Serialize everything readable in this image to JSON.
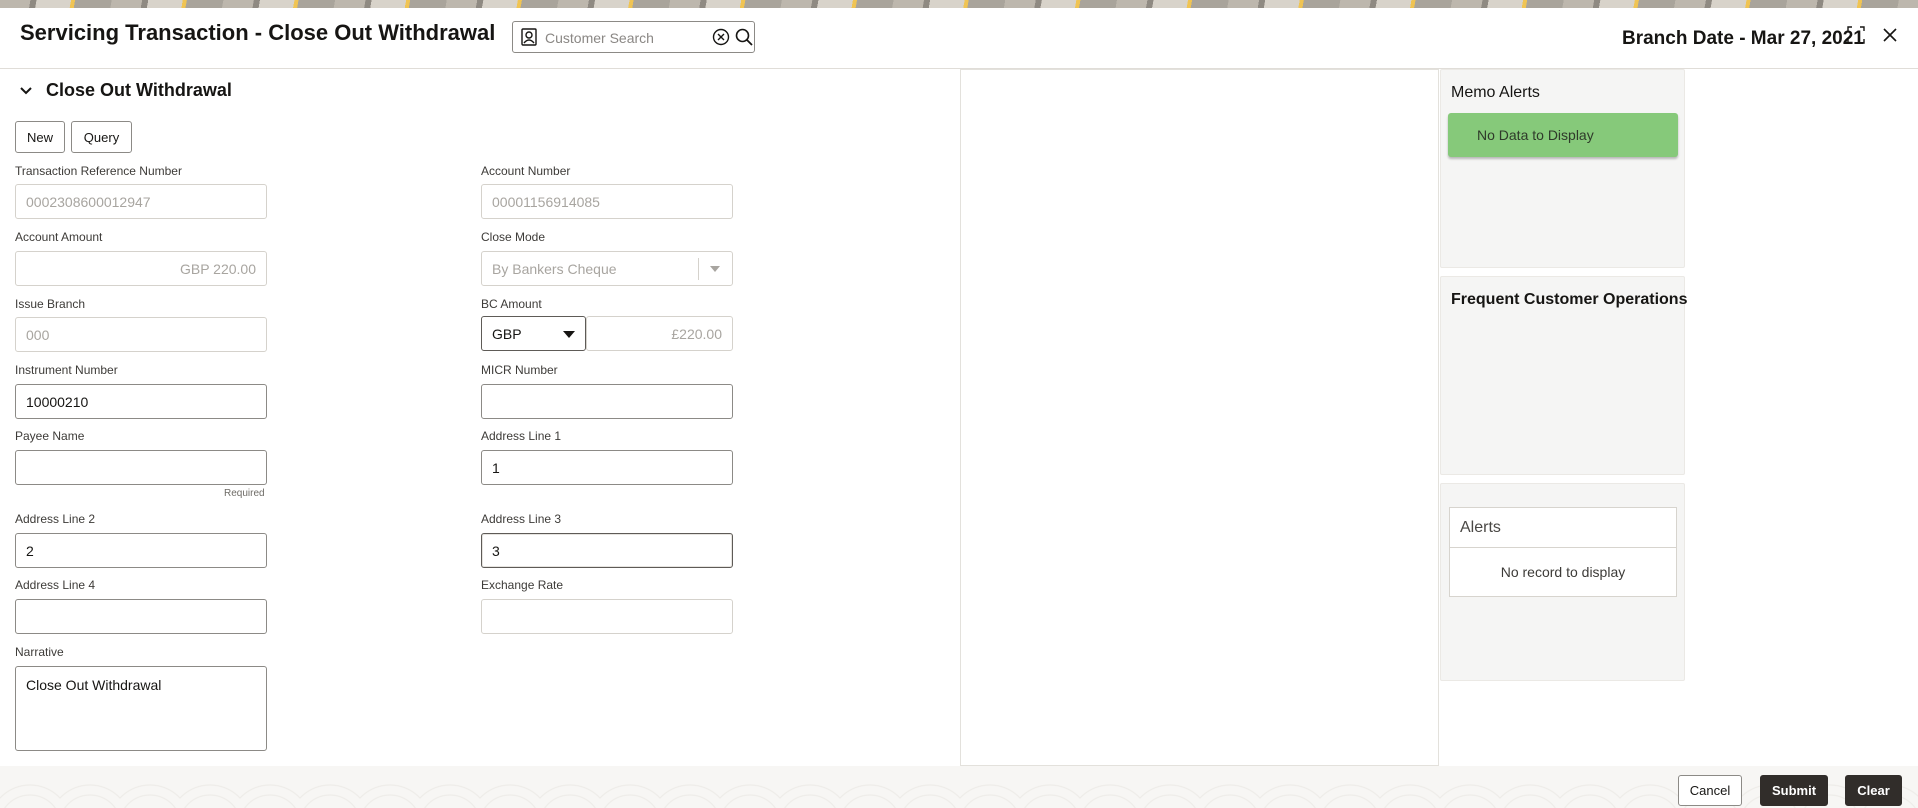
{
  "header": {
    "title": "Servicing Transaction - Close Out Withdrawal",
    "search_placeholder": "Customer Search",
    "branch_date": "Branch Date - Mar 27, 2021"
  },
  "section": {
    "title": "Close Out Withdrawal",
    "new_label": "New",
    "query_label": "Query"
  },
  "form": {
    "txn_ref": {
      "label": "Transaction Reference Number",
      "value": "0002308600012947"
    },
    "account_number": {
      "label": "Account Number",
      "value": "00001156914085"
    },
    "account_amount": {
      "label": "Account Amount",
      "value": "GBP 220.00"
    },
    "close_mode": {
      "label": "Close Mode",
      "value": "By Bankers Cheque"
    },
    "issue_branch": {
      "label": "Issue Branch",
      "value": "000"
    },
    "bc_amount": {
      "label": "BC Amount",
      "currency": "GBP",
      "value": "£220.00"
    },
    "instrument_number": {
      "label": "Instrument Number",
      "value": "10000210"
    },
    "micr_number": {
      "label": "MICR Number",
      "value": ""
    },
    "payee_name": {
      "label": "Payee Name",
      "value": "",
      "hint": "Required"
    },
    "address_line_1": {
      "label": "Address Line 1",
      "value": "1"
    },
    "address_line_2": {
      "label": "Address Line 2",
      "value": "2"
    },
    "address_line_3": {
      "label": "Address Line 3",
      "value": "3"
    },
    "address_line_4": {
      "label": "Address Line 4",
      "value": ""
    },
    "exchange_rate": {
      "label": "Exchange Rate",
      "value": ""
    },
    "narrative": {
      "label": "Narrative",
      "value": "Close Out Withdrawal"
    }
  },
  "side": {
    "memo_alerts": {
      "title": "Memo Alerts",
      "empty": "No Data to Display",
      "color": "#86c97a"
    },
    "frequent_ops": {
      "title": "Frequent Customer Operations"
    },
    "alerts": {
      "title": "Alerts",
      "empty": "No record to display"
    }
  },
  "footer": {
    "cancel_label": "Cancel",
    "submit_label": "Submit",
    "clear_label": "Clear"
  },
  "colors": {
    "primary_dark": "#312d2a",
    "border": "#8c8a86"
  }
}
